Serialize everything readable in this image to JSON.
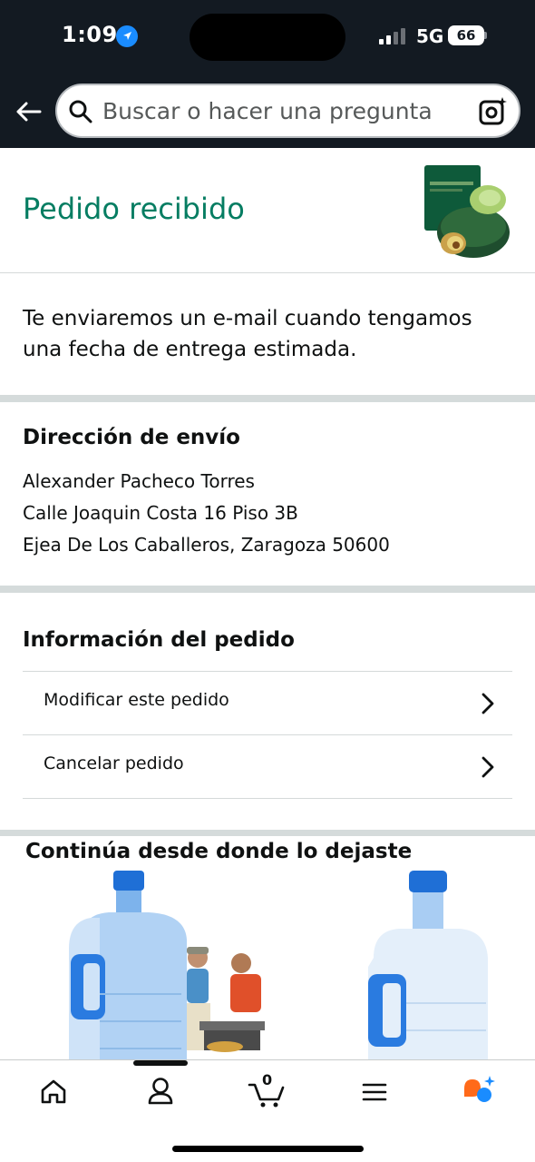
{
  "status_bar": {
    "time": "1:09",
    "network": "5G",
    "battery": "66"
  },
  "header": {
    "search_placeholder": "Buscar o hacer una pregunta"
  },
  "order": {
    "title": "Pedido recibido",
    "message": "Te enviaremos un e-mail cuando tengamos una fecha de entrega estimada."
  },
  "shipping": {
    "heading": "Dirección de envío",
    "name": "Alexander Pacheco Torres",
    "street": "Calle Joaquin Costa 16 Piso 3B",
    "city": "Ejea De Los Caballeros, Zaragoza 50600"
  },
  "order_info": {
    "heading": "Información del pedido",
    "items": [
      {
        "label": "Modificar este pedido"
      },
      {
        "label": "Cancelar pedido"
      }
    ]
  },
  "continue": {
    "title": "Continúa desde donde lo dejaste"
  },
  "bottom_nav": {
    "cart_count": "0",
    "items": [
      "home-icon",
      "account-icon",
      "cart-icon",
      "menu-icon",
      "assistant-icon"
    ]
  },
  "colors": {
    "header_bg": "#131a22",
    "title_green": "#067d62",
    "accent_orange": "#ff6a1a",
    "accent_blue": "#1a8cff"
  }
}
